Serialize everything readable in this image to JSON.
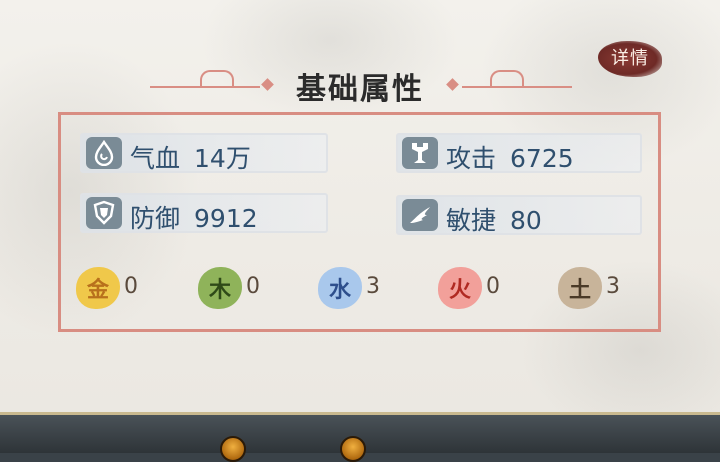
{
  "header": {
    "title": "基础属性",
    "details_label": "详情"
  },
  "stats": [
    {
      "name": "气血",
      "value": "14万",
      "icon": "blood-drop-icon"
    },
    {
      "name": "攻击",
      "value": "6725",
      "icon": "attack-icon"
    },
    {
      "name": "防御",
      "value": "9912",
      "icon": "shield-icon"
    },
    {
      "name": "敏捷",
      "value": "80",
      "icon": "agility-wing-icon"
    }
  ],
  "elements": [
    {
      "glyph": "金",
      "count": "0",
      "color": "#f0c84a",
      "text_color": "#b8701c"
    },
    {
      "glyph": "木",
      "count": "0",
      "color": "#8fb35a",
      "text_color": "#2f4a18"
    },
    {
      "glyph": "水",
      "count": "3",
      "color": "#a9c8ec",
      "text_color": "#2e4f8c"
    },
    {
      "glyph": "火",
      "count": "0",
      "color": "#f2a09a",
      "text_color": "#b02a22"
    },
    {
      "glyph": "土",
      "count": "3",
      "color": "#c8b49a",
      "text_color": "#4a3a28"
    }
  ],
  "colors": {
    "accent_line": "#d88d82",
    "stat_text": "#2f4f6e",
    "details_button": "#7a302c"
  }
}
